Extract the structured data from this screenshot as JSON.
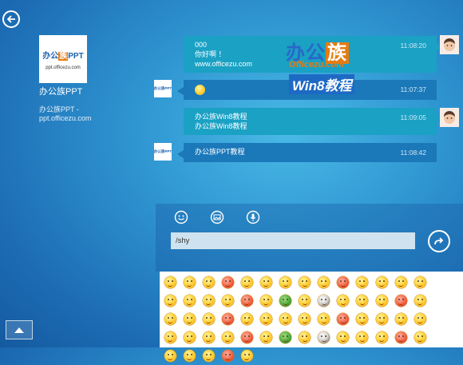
{
  "contact": {
    "logo_text_a": "办公",
    "logo_text_hl": "族",
    "logo_text_b": "PPT",
    "logo_url": "ppt.officezu.com",
    "name": "办公族PPT",
    "sub_line1": "办公族PPT -",
    "sub_line2": "ppt.officezu.com"
  },
  "messages": [
    {
      "lines": [
        "000",
        "你好啊 ！",
        "www.officezu.com"
      ],
      "time": "11:08:20",
      "direction": "out"
    },
    {
      "lines": [
        "shy-emoji"
      ],
      "time": "11:07:37",
      "direction": "in"
    },
    {
      "lines": [
        "办公族Win8教程",
        "办公族Win8教程"
      ],
      "time": "11:09:05",
      "direction": "out"
    },
    {
      "lines": [
        "办公族PPT教程"
      ],
      "time": "11:08:42",
      "direction": "in"
    }
  ],
  "watermark": {
    "line1_a": "办公",
    "line1_hl": "族",
    "line2": "Officezu.com",
    "line3": "Win8教程"
  },
  "compose": {
    "input_value": "/shy",
    "tools": [
      "smiley-icon",
      "image-icon",
      "microphone-icon"
    ]
  },
  "emoji_count": 61,
  "colors": {
    "accent": "#1aa1c4",
    "incoming": "#1b78b9",
    "brand_blue": "#1c62b0",
    "brand_orange": "#e47c13"
  }
}
